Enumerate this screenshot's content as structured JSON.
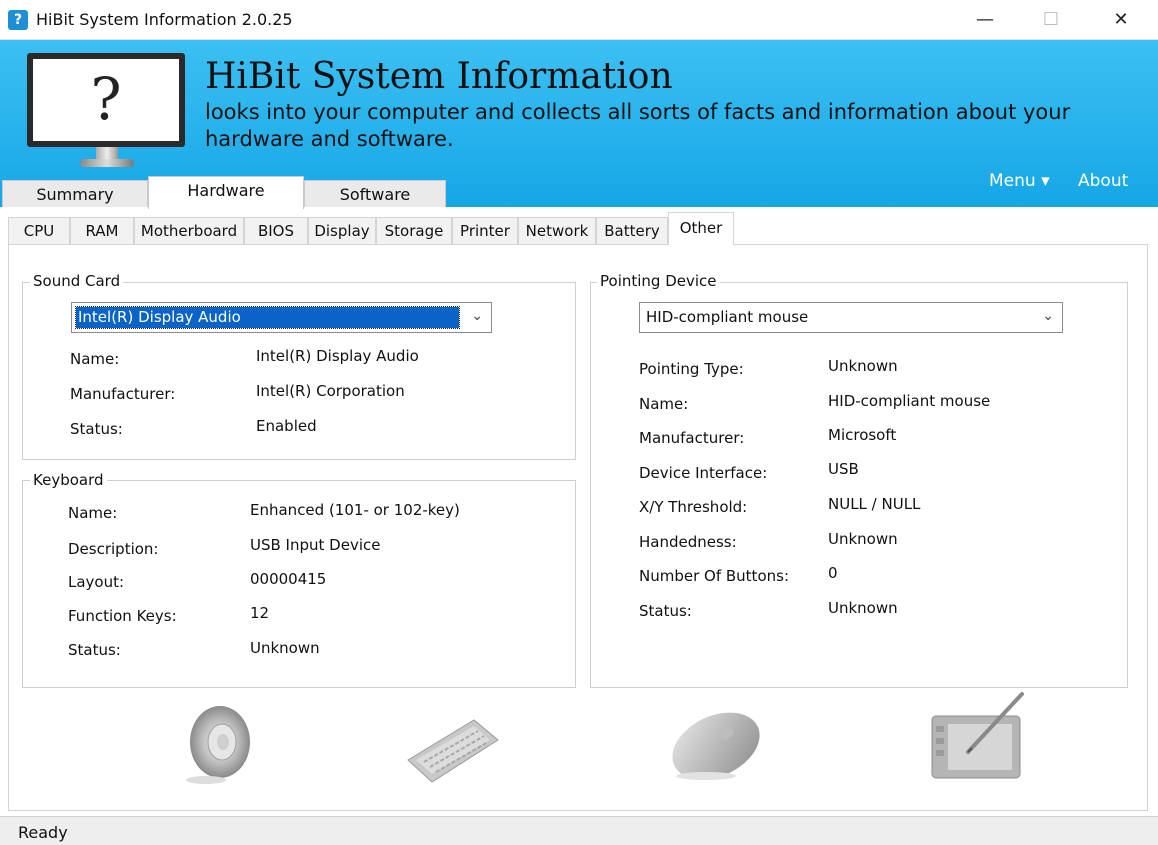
{
  "window": {
    "title": "HiBit System Information 2.0.25"
  },
  "banner": {
    "title": "HiBit System Information",
    "subtitle": "looks into your computer and collects all sorts of facts and information about your hardware and software.",
    "monitor_glyph": "?",
    "menu_label": "Menu ▾",
    "about_label": "About"
  },
  "main_tabs": [
    {
      "label": "Summary"
    },
    {
      "label": "Hardware"
    },
    {
      "label": "Software"
    }
  ],
  "sub_tabs": [
    {
      "label": "CPU"
    },
    {
      "label": "RAM"
    },
    {
      "label": "Motherboard"
    },
    {
      "label": "BIOS"
    },
    {
      "label": "Display"
    },
    {
      "label": "Storage"
    },
    {
      "label": "Printer"
    },
    {
      "label": "Network"
    },
    {
      "label": "Battery"
    },
    {
      "label": "Other"
    }
  ],
  "active_main_tab": "Hardware",
  "active_sub_tab": "Other",
  "sound_card": {
    "group_title": "Sound Card",
    "selected": "Intel(R) Display Audio",
    "fields": [
      {
        "label": "Name:",
        "value": "Intel(R) Display Audio"
      },
      {
        "label": "Manufacturer:",
        "value": "Intel(R) Corporation"
      },
      {
        "label": "Status:",
        "value": "Enabled"
      }
    ]
  },
  "keyboard": {
    "group_title": "Keyboard",
    "fields": [
      {
        "label": "Name:",
        "value": "Enhanced (101- or 102-key)"
      },
      {
        "label": "Description:",
        "value": "USB Input Device"
      },
      {
        "label": "Layout:",
        "value": "00000415"
      },
      {
        "label": "Function Keys:",
        "value": "12"
      },
      {
        "label": "Status:",
        "value": "Unknown"
      }
    ]
  },
  "pointing_device": {
    "group_title": "Pointing Device",
    "selected": "HID-compliant mouse",
    "fields": [
      {
        "label": "Pointing Type:",
        "value": "Unknown"
      },
      {
        "label": "Name:",
        "value": "HID-compliant mouse"
      },
      {
        "label": "Manufacturer:",
        "value": "Microsoft"
      },
      {
        "label": "Device Interface:",
        "value": "USB"
      },
      {
        "label": "X/Y Threshold:",
        "value": "NULL / NULL"
      },
      {
        "label": "Handedness:",
        "value": "Unknown"
      },
      {
        "label": "Number Of Buttons:",
        "value": "0"
      },
      {
        "label": "Status:",
        "value": "Unknown"
      }
    ]
  },
  "status_bar": {
    "text": "Ready"
  },
  "colors": {
    "banner": "#1aa9e8",
    "selection": "#0a64c8"
  }
}
